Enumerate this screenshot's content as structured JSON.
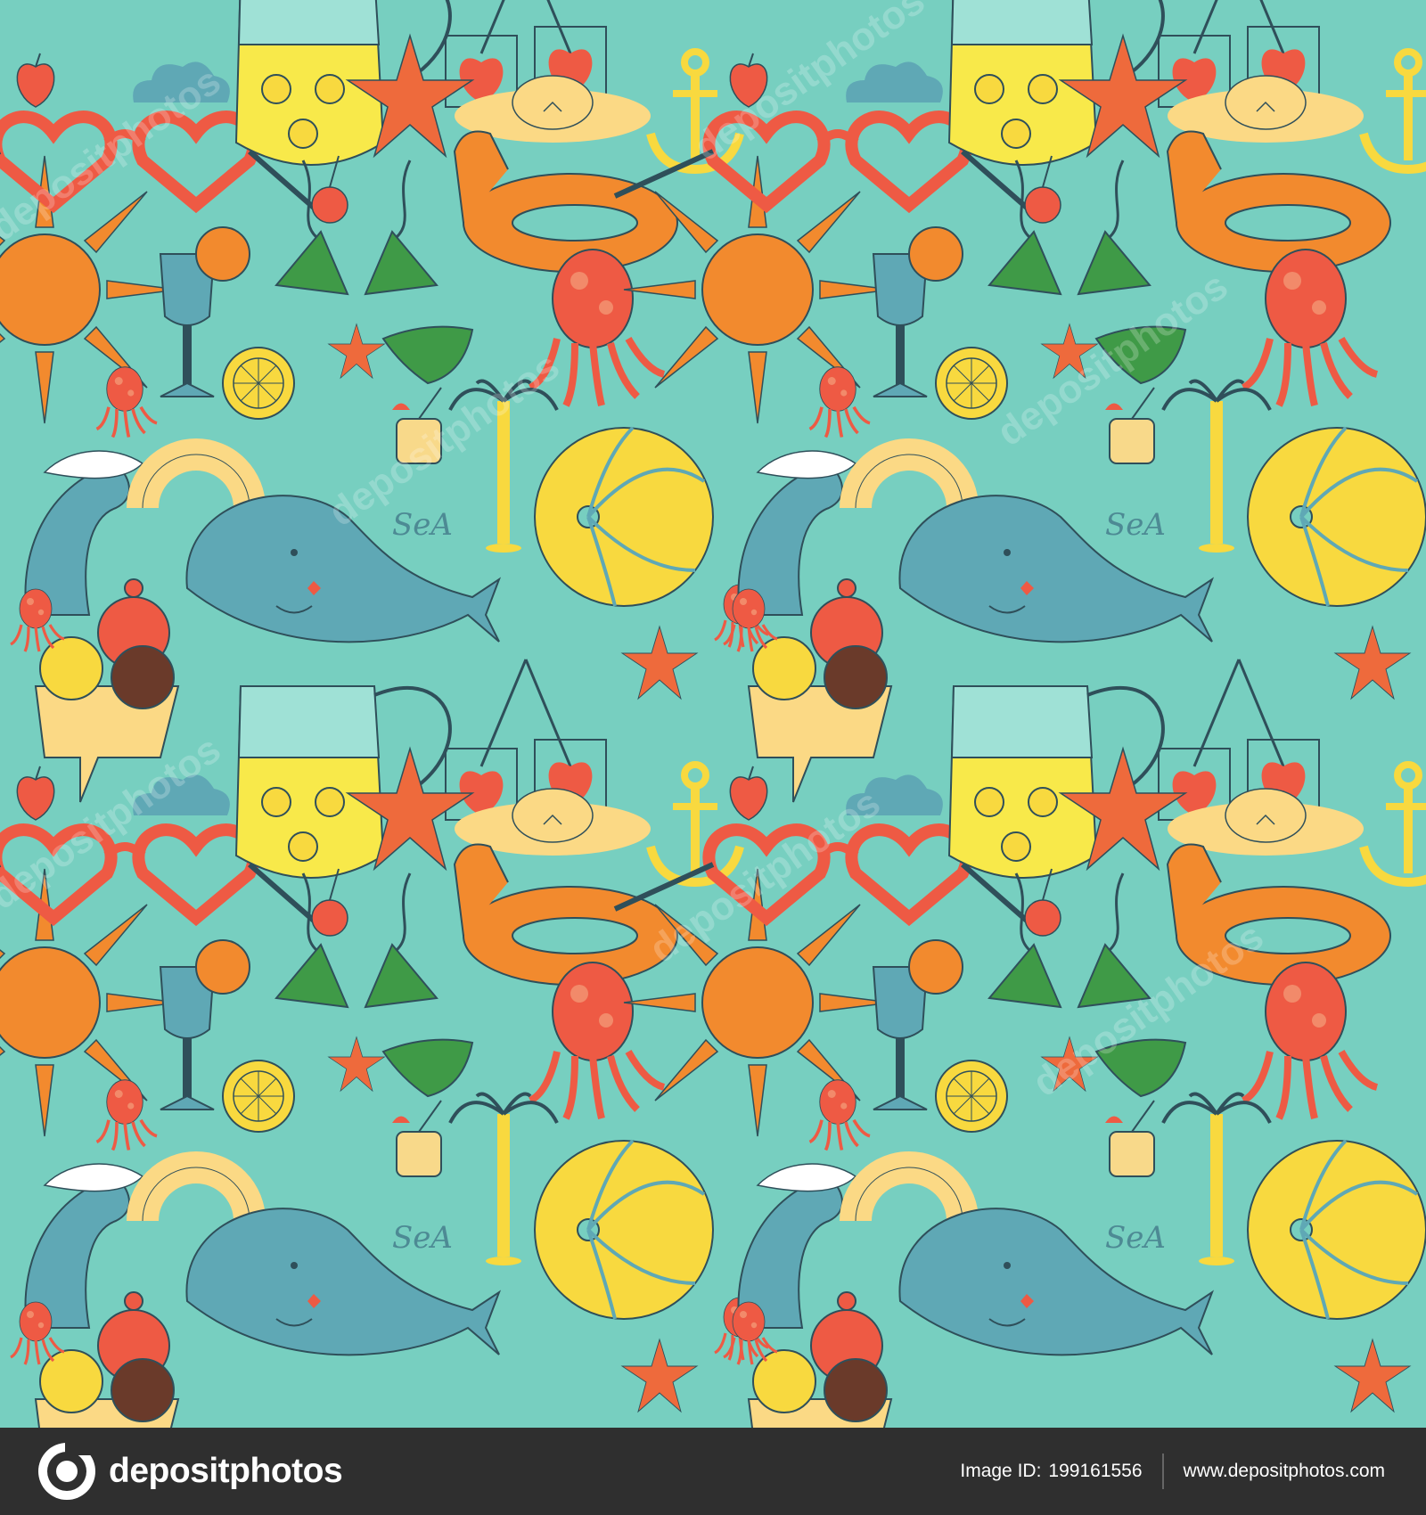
{
  "pattern": {
    "background_color": "#77cfc0",
    "motifs": [
      "sun-icon",
      "heart-glasses-icon",
      "lemonade-jug-icon",
      "cherries-icon",
      "starfish-icon",
      "sun-hat-icon",
      "anchor-icon",
      "swim-ring-icon",
      "bikini-icon",
      "cherry-icon",
      "cocktail-glass-icon",
      "lemon-slice-icon",
      "octopus-icon",
      "palm-tree-icon",
      "wave-icon",
      "rainbow-icon",
      "whale-icon",
      "beach-ball-icon",
      "ice-cream-icon",
      "cloud-icon",
      "coconut-drink-icon",
      "apple-icon"
    ],
    "whale_text": "SeA",
    "watermark_text": "depositphotos"
  },
  "footer": {
    "brand_name": "depositphotos",
    "image_id_label": "Image ID:",
    "image_id": "199161556",
    "site_url": "www.depositphotos.com"
  },
  "colors": {
    "footer_bg": "#2f2f2f",
    "orange": "#f28a2e",
    "red": "#ee5a44",
    "yellow": "#f8d93f",
    "green": "#3f9a47",
    "blue": "#5fa8b5",
    "sand": "#fbd985"
  }
}
